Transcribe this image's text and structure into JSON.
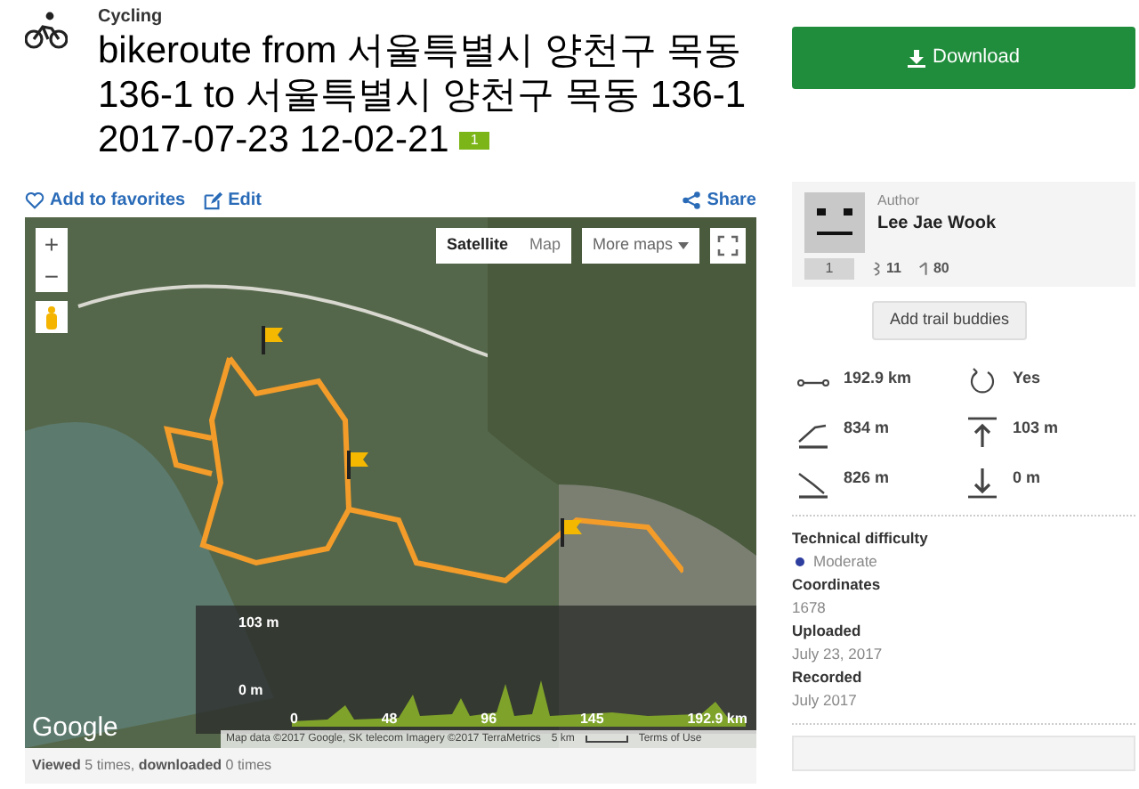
{
  "activity": "Cycling",
  "title_lines": [
    "bikeroute from 서울특별시 양천구 목동",
    "136-1 to 서울특별시 양천구 목동 136-1",
    "2017-07-23 12-02-21"
  ],
  "badge": "1",
  "actions": [
    {
      "kind": "favorite",
      "label": "Add to favorites"
    },
    {
      "kind": "edit",
      "label": "Edit"
    },
    {
      "kind": "share",
      "label": "Share"
    }
  ],
  "map": {
    "map_types": [
      {
        "label": "Satellite",
        "selected": true
      },
      {
        "label": "Map",
        "selected": false
      }
    ],
    "more_maps": "More maps",
    "zoom_in": "+",
    "zoom_out": "−",
    "logo": "Google",
    "attribution": "Map data ©2017 Google, SK telecom Imagery ©2017 TerraMetrics",
    "scale": "5 km",
    "terms": "Terms of Use",
    "elevation": {
      "y_labels": [
        "103 m",
        "0 m"
      ],
      "x_labels": [
        "0",
        "48",
        "96",
        "145",
        "192.9 km"
      ]
    }
  },
  "footer": "**Viewed** 5 times, **downloaded** 0 times",
  "download": "Download",
  "author": {
    "label": "Author",
    "name": "Lee Jae Wook",
    "rank": "1",
    "stats": [
      {
        "kind": "followers",
        "value": "11"
      },
      {
        "kind": "trails",
        "value": "80"
      }
    ]
  },
  "add_buddies": "Add trail buddies",
  "stats": [
    {
      "kind": "distance",
      "value": "192.9 km"
    },
    {
      "kind": "loop",
      "value": "Yes"
    },
    {
      "kind": "ascent",
      "value": "834 m"
    },
    {
      "kind": "max_elevation",
      "value": "103 m"
    },
    {
      "kind": "descent",
      "value": "826 m"
    },
    {
      "kind": "min_elevation",
      "value": "0 m"
    }
  ],
  "details": [
    {
      "label": "Technical difficulty",
      "value": "Moderate",
      "color": "#2d3e9e"
    },
    {
      "label": "Coordinates",
      "value": "1678"
    },
    {
      "label": "Uploaded",
      "value": "July 23, 2017"
    },
    {
      "label": "Recorded",
      "value": "July 2017"
    }
  ]
}
